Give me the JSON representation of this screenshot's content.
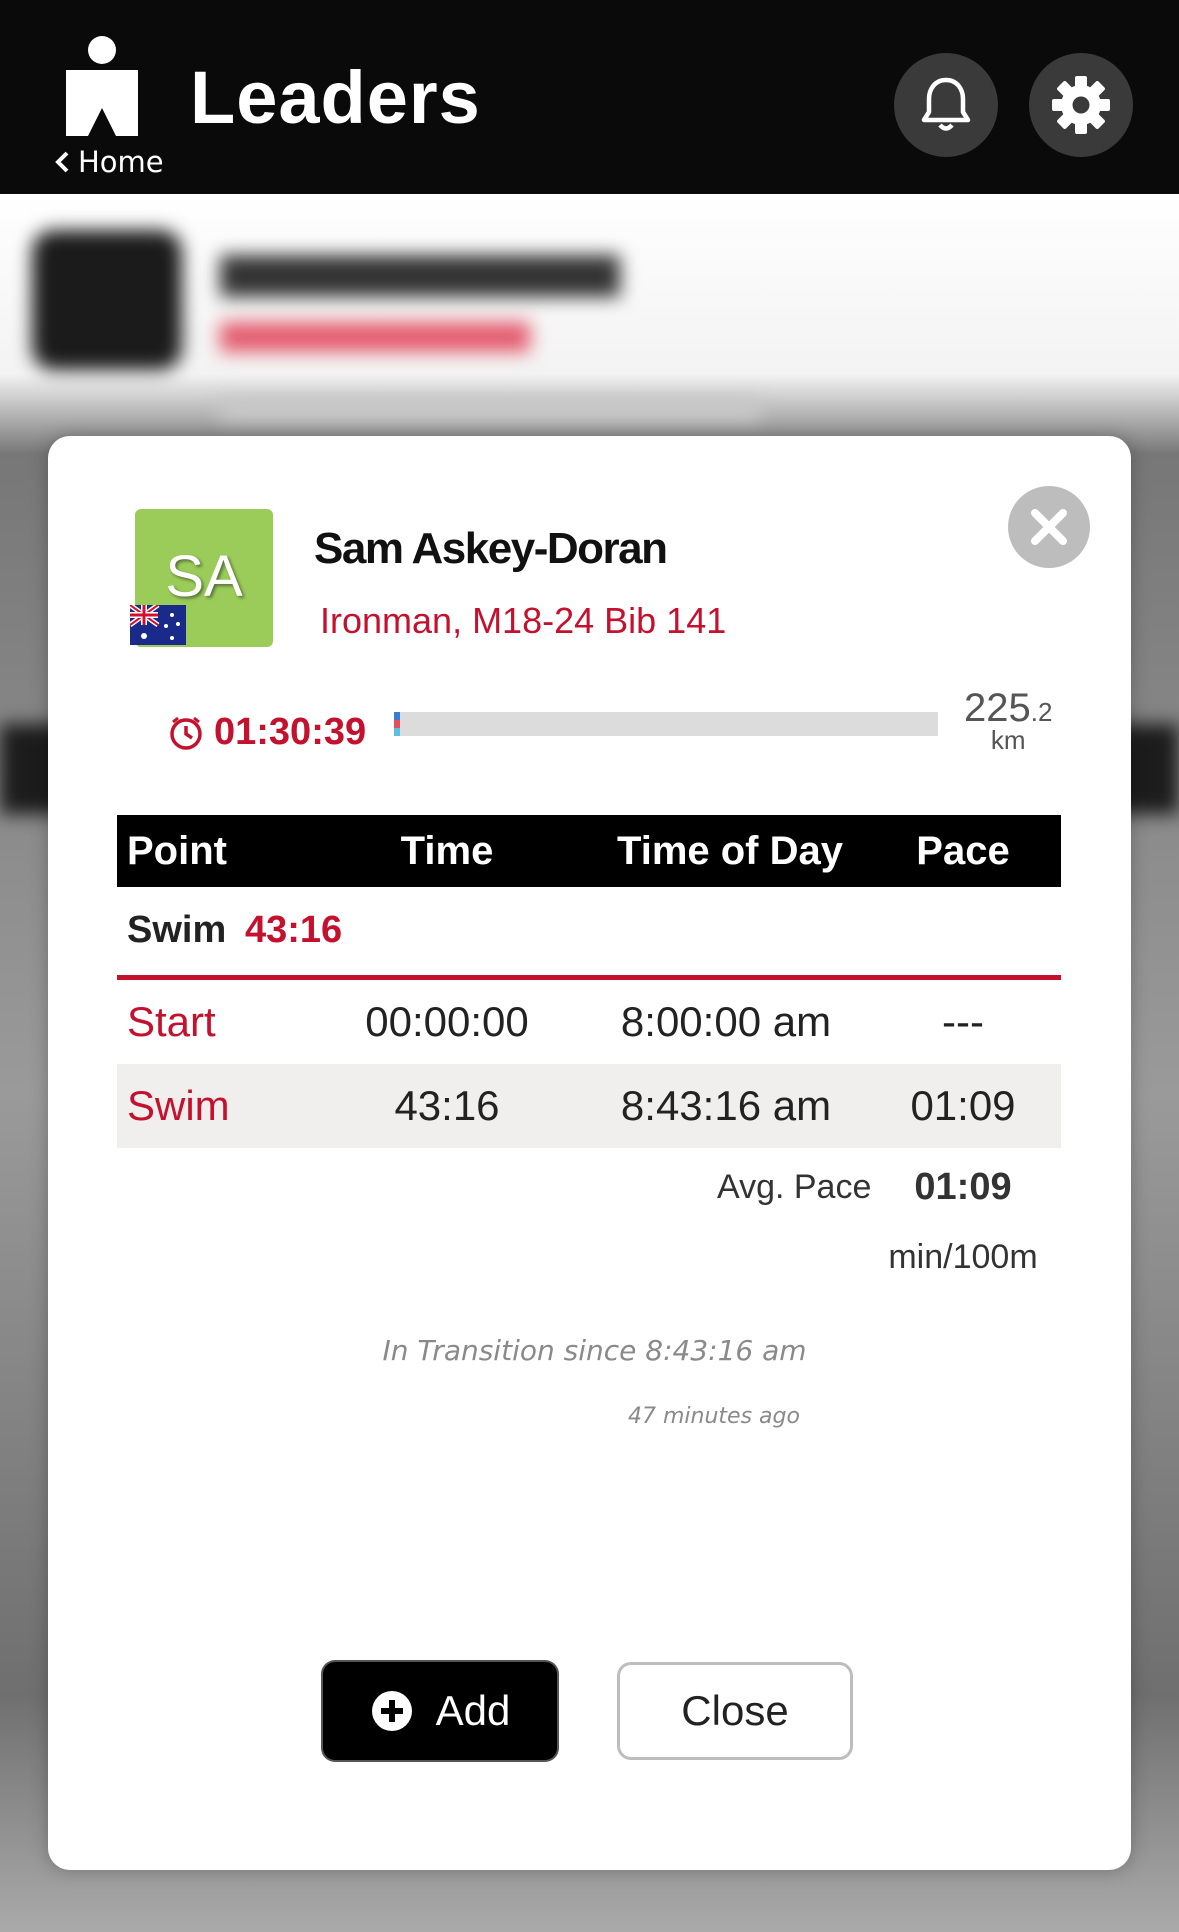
{
  "header": {
    "title": "Leaders",
    "back_label": "Home"
  },
  "icons": {
    "logo": "ironman-logo-icon",
    "back": "chevron-left-icon",
    "notifications": "bell-icon",
    "settings": "gear-icon",
    "close": "close-x-icon",
    "clock": "clock-icon",
    "add": "plus-circle-icon",
    "flag": "australia-flag-icon"
  },
  "athlete": {
    "initials": "SA",
    "name": "Sam Askey-Doran",
    "info": "Ironman, M18-24 Bib 141",
    "elapsed": "01:30:39",
    "distance_whole": "225",
    "distance_decimal": ".2",
    "distance_unit": "km",
    "progress_fraction": 0.01
  },
  "table": {
    "headers": [
      "Point",
      "Time",
      "Time of Day",
      "Pace"
    ],
    "section_label": "Swim",
    "section_time": "43:16",
    "rows": [
      {
        "point": "Start",
        "time": "00:00:00",
        "tod": "8:00:00 am",
        "pace": "---"
      },
      {
        "point": "Swim",
        "time": "43:16",
        "tod": "8:43:16 am",
        "pace": "01:09"
      }
    ],
    "avg_pace_label": "Avg. Pace",
    "avg_pace_value": "01:09",
    "avg_pace_unit": "min/100m"
  },
  "status": {
    "transition": "In Transition since 8:43:16 am",
    "ago": "47 minutes ago"
  },
  "buttons": {
    "add": "Add",
    "close": "Close"
  },
  "colors": {
    "accent": "#c3112e",
    "avatar_bg": "#9bcc5a",
    "header_bg": "#0a0a0a"
  }
}
